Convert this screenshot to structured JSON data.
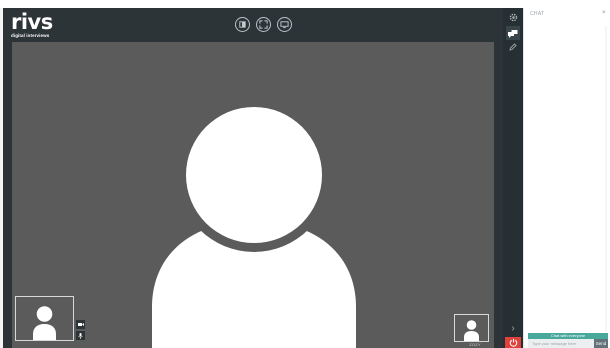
{
  "brand": {
    "name": "rivs",
    "tagline": "digital interviews"
  },
  "video_controls": [
    {
      "name": "exit-fullscreen-icon"
    },
    {
      "name": "fullscreen-icon"
    },
    {
      "name": "screen-share-icon"
    }
  ],
  "side_rail": {
    "items": [
      {
        "name": "settings-icon",
        "active": false
      },
      {
        "name": "chat-bubbles-icon",
        "active": true
      },
      {
        "name": "pen-icon",
        "active": false
      }
    ],
    "expand_symbol": "›"
  },
  "participant": {
    "name": "ZOZY"
  },
  "chat": {
    "title": "CHAT",
    "minimize_symbol": "×",
    "recipient_label": "Chat with everyone",
    "input_placeholder": "Type your message here",
    "send_label": "Send"
  },
  "colors": {
    "background": "#2d3438",
    "video": "#5b5b5b",
    "end_call": "#e0413b",
    "chat_accent": "#49a89c"
  }
}
